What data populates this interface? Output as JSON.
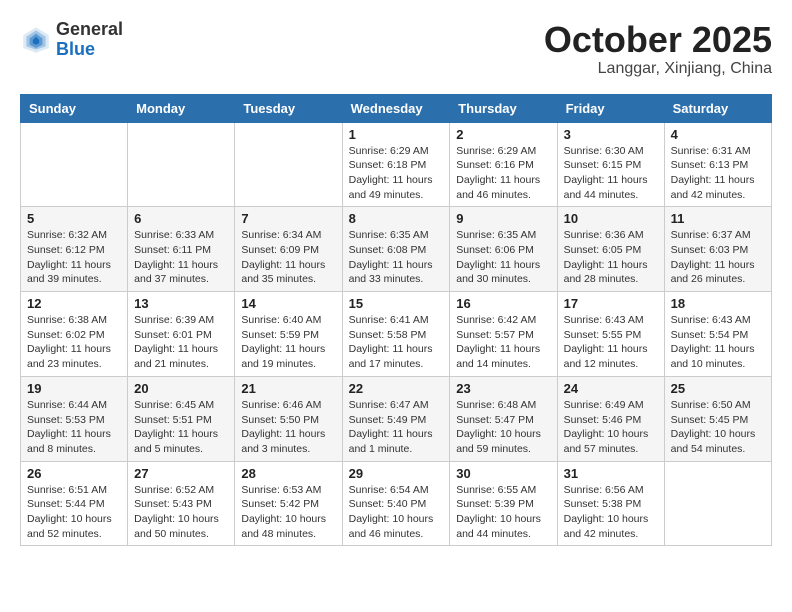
{
  "header": {
    "logo_general": "General",
    "logo_blue": "Blue",
    "month_title": "October 2025",
    "location": "Langgar, Xinjiang, China"
  },
  "weekdays": [
    "Sunday",
    "Monday",
    "Tuesday",
    "Wednesday",
    "Thursday",
    "Friday",
    "Saturday"
  ],
  "weeks": [
    [
      {
        "day": "",
        "info": ""
      },
      {
        "day": "",
        "info": ""
      },
      {
        "day": "",
        "info": ""
      },
      {
        "day": "1",
        "info": "Sunrise: 6:29 AM\nSunset: 6:18 PM\nDaylight: 11 hours\nand 49 minutes."
      },
      {
        "day": "2",
        "info": "Sunrise: 6:29 AM\nSunset: 6:16 PM\nDaylight: 11 hours\nand 46 minutes."
      },
      {
        "day": "3",
        "info": "Sunrise: 6:30 AM\nSunset: 6:15 PM\nDaylight: 11 hours\nand 44 minutes."
      },
      {
        "day": "4",
        "info": "Sunrise: 6:31 AM\nSunset: 6:13 PM\nDaylight: 11 hours\nand 42 minutes."
      }
    ],
    [
      {
        "day": "5",
        "info": "Sunrise: 6:32 AM\nSunset: 6:12 PM\nDaylight: 11 hours\nand 39 minutes."
      },
      {
        "day": "6",
        "info": "Sunrise: 6:33 AM\nSunset: 6:11 PM\nDaylight: 11 hours\nand 37 minutes."
      },
      {
        "day": "7",
        "info": "Sunrise: 6:34 AM\nSunset: 6:09 PM\nDaylight: 11 hours\nand 35 minutes."
      },
      {
        "day": "8",
        "info": "Sunrise: 6:35 AM\nSunset: 6:08 PM\nDaylight: 11 hours\nand 33 minutes."
      },
      {
        "day": "9",
        "info": "Sunrise: 6:35 AM\nSunset: 6:06 PM\nDaylight: 11 hours\nand 30 minutes."
      },
      {
        "day": "10",
        "info": "Sunrise: 6:36 AM\nSunset: 6:05 PM\nDaylight: 11 hours\nand 28 minutes."
      },
      {
        "day": "11",
        "info": "Sunrise: 6:37 AM\nSunset: 6:03 PM\nDaylight: 11 hours\nand 26 minutes."
      }
    ],
    [
      {
        "day": "12",
        "info": "Sunrise: 6:38 AM\nSunset: 6:02 PM\nDaylight: 11 hours\nand 23 minutes."
      },
      {
        "day": "13",
        "info": "Sunrise: 6:39 AM\nSunset: 6:01 PM\nDaylight: 11 hours\nand 21 minutes."
      },
      {
        "day": "14",
        "info": "Sunrise: 6:40 AM\nSunset: 5:59 PM\nDaylight: 11 hours\nand 19 minutes."
      },
      {
        "day": "15",
        "info": "Sunrise: 6:41 AM\nSunset: 5:58 PM\nDaylight: 11 hours\nand 17 minutes."
      },
      {
        "day": "16",
        "info": "Sunrise: 6:42 AM\nSunset: 5:57 PM\nDaylight: 11 hours\nand 14 minutes."
      },
      {
        "day": "17",
        "info": "Sunrise: 6:43 AM\nSunset: 5:55 PM\nDaylight: 11 hours\nand 12 minutes."
      },
      {
        "day": "18",
        "info": "Sunrise: 6:43 AM\nSunset: 5:54 PM\nDaylight: 11 hours\nand 10 minutes."
      }
    ],
    [
      {
        "day": "19",
        "info": "Sunrise: 6:44 AM\nSunset: 5:53 PM\nDaylight: 11 hours\nand 8 minutes."
      },
      {
        "day": "20",
        "info": "Sunrise: 6:45 AM\nSunset: 5:51 PM\nDaylight: 11 hours\nand 5 minutes."
      },
      {
        "day": "21",
        "info": "Sunrise: 6:46 AM\nSunset: 5:50 PM\nDaylight: 11 hours\nand 3 minutes."
      },
      {
        "day": "22",
        "info": "Sunrise: 6:47 AM\nSunset: 5:49 PM\nDaylight: 11 hours\nand 1 minute."
      },
      {
        "day": "23",
        "info": "Sunrise: 6:48 AM\nSunset: 5:47 PM\nDaylight: 10 hours\nand 59 minutes."
      },
      {
        "day": "24",
        "info": "Sunrise: 6:49 AM\nSunset: 5:46 PM\nDaylight: 10 hours\nand 57 minutes."
      },
      {
        "day": "25",
        "info": "Sunrise: 6:50 AM\nSunset: 5:45 PM\nDaylight: 10 hours\nand 54 minutes."
      }
    ],
    [
      {
        "day": "26",
        "info": "Sunrise: 6:51 AM\nSunset: 5:44 PM\nDaylight: 10 hours\nand 52 minutes."
      },
      {
        "day": "27",
        "info": "Sunrise: 6:52 AM\nSunset: 5:43 PM\nDaylight: 10 hours\nand 50 minutes."
      },
      {
        "day": "28",
        "info": "Sunrise: 6:53 AM\nSunset: 5:42 PM\nDaylight: 10 hours\nand 48 minutes."
      },
      {
        "day": "29",
        "info": "Sunrise: 6:54 AM\nSunset: 5:40 PM\nDaylight: 10 hours\nand 46 minutes."
      },
      {
        "day": "30",
        "info": "Sunrise: 6:55 AM\nSunset: 5:39 PM\nDaylight: 10 hours\nand 44 minutes."
      },
      {
        "day": "31",
        "info": "Sunrise: 6:56 AM\nSunset: 5:38 PM\nDaylight: 10 hours\nand 42 minutes."
      },
      {
        "day": "",
        "info": ""
      }
    ]
  ]
}
